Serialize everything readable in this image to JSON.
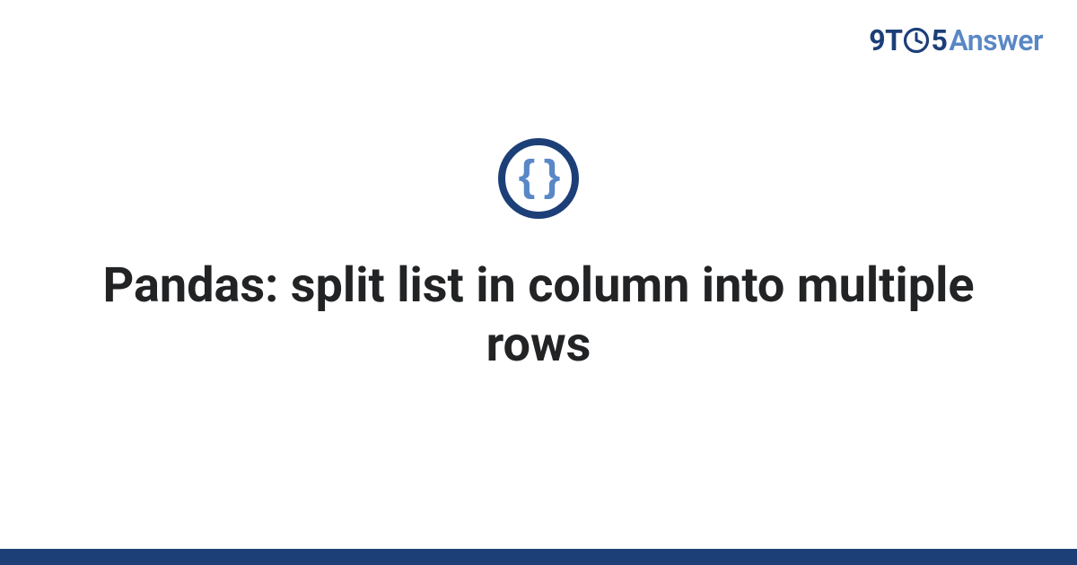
{
  "logo": {
    "part1": "9T",
    "part2": "5",
    "part3": "Answer"
  },
  "topic_icon": {
    "glyph": "{ }",
    "semantic": "code-braces-icon"
  },
  "title": "Pandas: split list in column into multiple rows",
  "colors": {
    "brand_dark": "#1c3f78",
    "brand_light": "#5a87c5"
  }
}
